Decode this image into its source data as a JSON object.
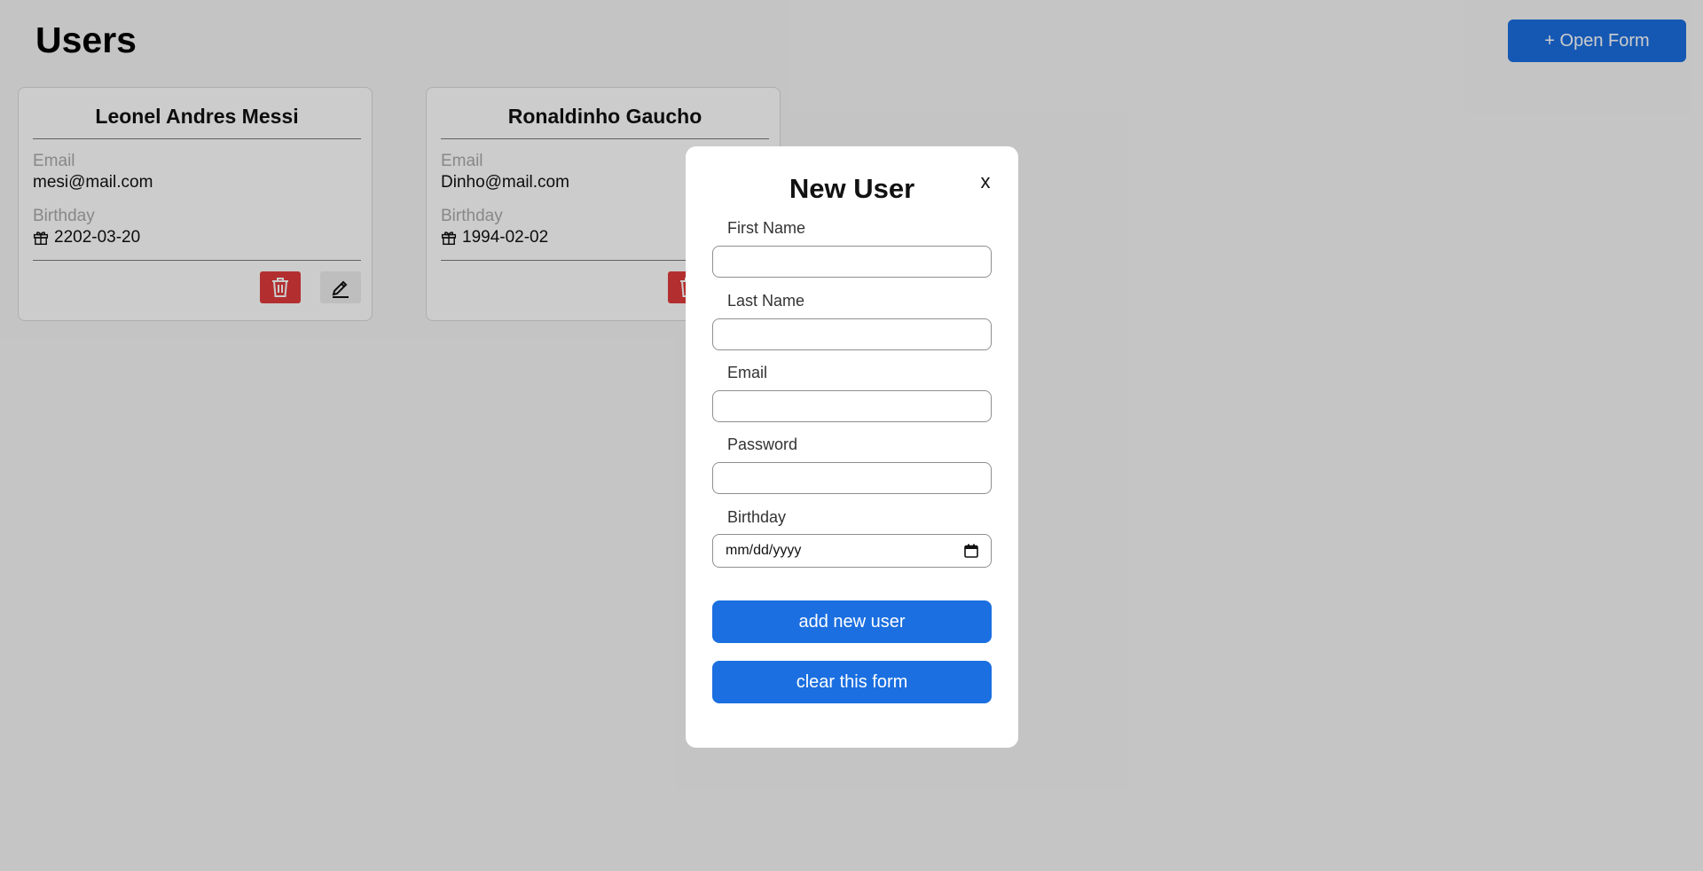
{
  "header": {
    "title": "Users",
    "open_form_label": "+ Open Form"
  },
  "users": [
    {
      "name": "Leonel Andres Messi",
      "email_label": "Email",
      "email": "mesi@mail.com",
      "birthday_label": "Birthday",
      "birthday": "2202-03-20"
    },
    {
      "name": "Ronaldinho Gaucho",
      "email_label": "Email",
      "email": "Dinho@mail.com",
      "birthday_label": "Birthday",
      "birthday": "1994-02-02"
    }
  ],
  "modal": {
    "title": "New User",
    "close_label": "x",
    "fields": {
      "first_name": {
        "label": "First Name",
        "value": ""
      },
      "last_name": {
        "label": "Last Name",
        "value": ""
      },
      "email": {
        "label": "Email",
        "value": ""
      },
      "password": {
        "label": "Password",
        "value": ""
      },
      "birthday": {
        "label": "Birthday",
        "placeholder": "mm/dd/yyyy"
      }
    },
    "submit_label": "add new user",
    "clear_label": "clear this form"
  },
  "icons": {
    "delete": "trash-icon",
    "edit": "pencil-icon",
    "birthday": "gift-icon",
    "calendar": "calendar-icon"
  },
  "colors": {
    "primary": "#1b6fe0",
    "danger": "#e03b3b",
    "overlay": "rgba(0,0,0,0.2)"
  }
}
